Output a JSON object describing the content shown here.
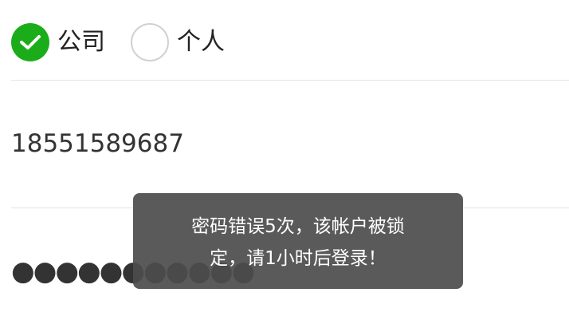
{
  "account_type": {
    "options": [
      {
        "label": "公司",
        "checked": true
      },
      {
        "label": "个人",
        "checked": false
      }
    ]
  },
  "form": {
    "phone_value": "18551589687",
    "password_mask": "●●●●●●●●●●●"
  },
  "toast": {
    "message": "密码错误5次，该帐户被锁定，请1小时后登录！"
  },
  "colors": {
    "checked_green": "#1aad19",
    "unchecked_border": "#d1d1d1",
    "toast_bg": "#4c4c4c",
    "divider": "#e5e5e5"
  },
  "icons": {
    "checked": "checkmark-icon"
  }
}
